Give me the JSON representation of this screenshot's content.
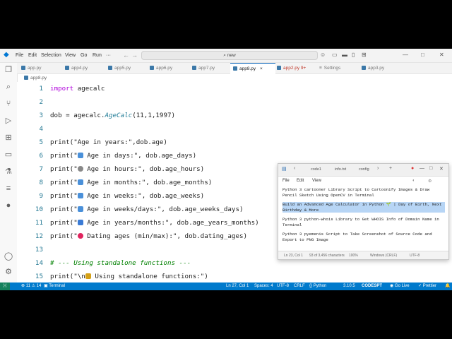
{
  "titlebar": {
    "menu": [
      "File",
      "Edit",
      "Selection",
      "View",
      "Go",
      "Run"
    ],
    "more": "···",
    "search": "new"
  },
  "tabs": [
    {
      "label": "app.py"
    },
    {
      "label": "app4.py"
    },
    {
      "label": "app5.py"
    },
    {
      "label": "app6.py"
    },
    {
      "label": "app7.py"
    },
    {
      "label": "app8.py",
      "close": "×"
    },
    {
      "label": "app2.py 9+"
    },
    {
      "label": "Settings"
    },
    {
      "label": "app3.py"
    }
  ],
  "breadcrumb": "app8.py",
  "code": [
    {
      "n": "1",
      "parts": [
        {
          "t": "import",
          "c": "kw"
        },
        {
          "t": " agecalc"
        }
      ]
    },
    {
      "n": "2",
      "parts": []
    },
    {
      "n": "3",
      "parts": [
        {
          "t": "dob = agecalc."
        },
        {
          "t": "AgeCalc",
          "c": "fn"
        },
        {
          "t": "(11,1,1997)"
        }
      ]
    },
    {
      "n": "4",
      "parts": []
    },
    {
      "n": "5",
      "parts": [
        {
          "t": "print(\"Age in years:\",dob.age)"
        }
      ]
    },
    {
      "n": "6",
      "parts": [
        {
          "t": "print(\""
        },
        {
          "e": "calendar"
        },
        {
          "t": " Age in days:\", dob.age_days)"
        }
      ]
    },
    {
      "n": "7",
      "parts": [
        {
          "t": "print(\""
        },
        {
          "e": "clock"
        },
        {
          "t": " Age in hours:\", dob.age_hours)"
        }
      ]
    },
    {
      "n": "8",
      "parts": [
        {
          "t": "print(\""
        },
        {
          "e": "calendar"
        },
        {
          "t": " Age in months:\", dob.age_months)"
        }
      ]
    },
    {
      "n": "9",
      "parts": [
        {
          "t": "print(\""
        },
        {
          "e": "calendar"
        },
        {
          "t": " Age in weeks:\", dob.age_weeks)"
        }
      ]
    },
    {
      "n": "10",
      "parts": [
        {
          "t": "print(\""
        },
        {
          "e": "calendar"
        },
        {
          "t": " Age in weeks/days:\", dob.age_weeks_days)"
        }
      ]
    },
    {
      "n": "11",
      "parts": [
        {
          "t": "print(\""
        },
        {
          "e": "numbers"
        },
        {
          "t": " Age in years/months:\", dob.age_years_months)"
        }
      ]
    },
    {
      "n": "12",
      "parts": [
        {
          "t": "print(\""
        },
        {
          "e": "heart"
        },
        {
          "t": " Dating ages (min/max):\", dob.dating_ages)"
        }
      ]
    },
    {
      "n": "13",
      "parts": []
    },
    {
      "n": "14",
      "parts": [
        {
          "t": "# --- Using standalone functions ---",
          "c": "cm"
        }
      ]
    },
    {
      "n": "15",
      "parts": [
        {
          "t": "print(\"\\n"
        },
        {
          "e": "sparkle"
        },
        {
          "t": " Using standalone functions:\")"
        }
      ]
    }
  ],
  "status": {
    "remote": "⟩⟨",
    "problems": "⊗ 11 ⚠ 14",
    "terminal": "Terminal",
    "position": "Ln 27, Col 1",
    "spaces": "Spaces: 4",
    "encoding": "UTF-8",
    "eol": "CRLF",
    "language": "Python",
    "version": "3.10.5",
    "brand": "CODESPT",
    "golive": "Go Live",
    "prettier": "Prettier"
  },
  "notepad": {
    "tabs": [
      "code1",
      "info.txt",
      "config"
    ],
    "add": "+",
    "menu": [
      "File",
      "Edit",
      "View"
    ],
    "paragraphs": [
      {
        "text": "Python 3 cartooner Library Script to Cartoonify Images & Draw Pencil Sketch Using OpenCV in Terminal",
        "selected": false
      },
      {
        "text": "Build an Advanced Age Calculator in Python 🌱 | Day of Birth, Next Birthday & More",
        "selected": true
      },
      {
        "text": "Python 3 python-whois Library to Get WHOIS Info of Domain Name in Terminal",
        "selected": false
      },
      {
        "text": "Python 3 pyemenis Script to Take Screenshot of Source Code and Export to PNG Image",
        "selected": false
      }
    ],
    "status": [
      "Ln 23, Col 1",
      "93 of 3,456 characters",
      "100%",
      "Windows (CRLF)",
      "UTF-8"
    ]
  },
  "colors": {
    "accent": "#007acc",
    "keyword": "#af00db",
    "class": "#267f99",
    "comment": "#008000",
    "selection": "#b7d5f5"
  }
}
